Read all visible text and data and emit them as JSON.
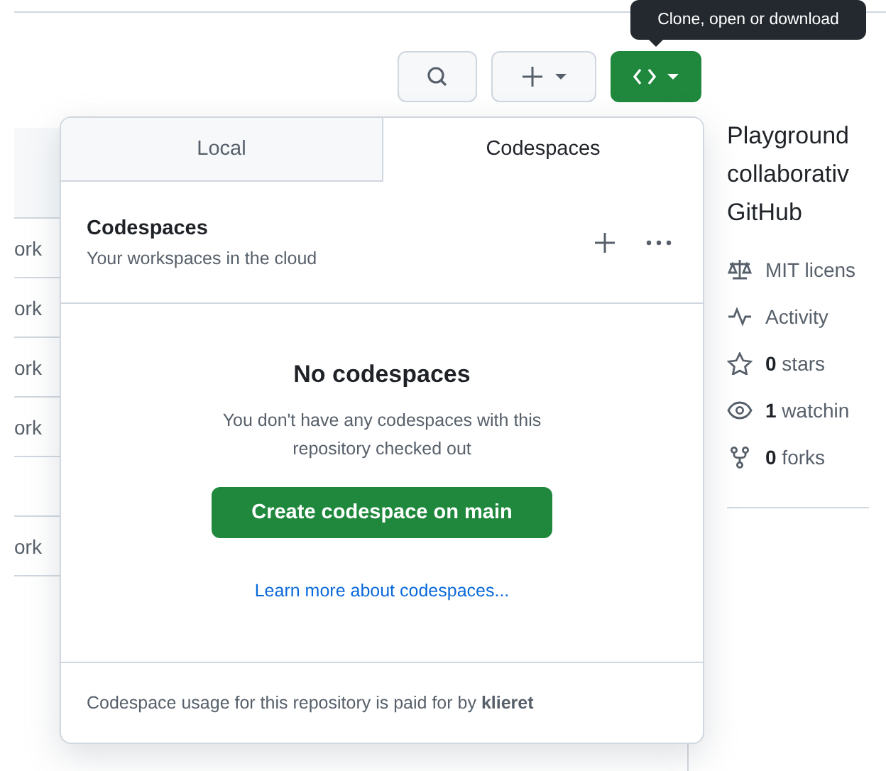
{
  "tooltip": {
    "text": "Clone, open or download"
  },
  "toolbar": {
    "buttons": [
      {
        "kind": "search"
      },
      {
        "kind": "add"
      },
      {
        "kind": "code"
      }
    ]
  },
  "file_rows": [
    {
      "kind": "file",
      "text": "ork"
    },
    {
      "kind": "file",
      "text": "ork"
    },
    {
      "kind": "file",
      "text": "ork"
    },
    {
      "kind": "file",
      "text": "ork"
    },
    {
      "kind": "blank"
    },
    {
      "kind": "file",
      "text": "ork"
    }
  ],
  "about": {
    "description_lines": [
      "Playground",
      "collaborativ",
      "GitHub"
    ],
    "stats": [
      {
        "kind": "license",
        "text": "MIT licens"
      },
      {
        "kind": "activity",
        "text": "Activity"
      },
      {
        "kind": "star",
        "text": "**0** stars"
      },
      {
        "kind": "eye",
        "text": "**1** watchin"
      },
      {
        "kind": "fork",
        "text": "**0** forks"
      }
    ]
  },
  "popover": {
    "tabs": [
      {
        "label": "Local",
        "selected": false
      },
      {
        "label": "Codespaces",
        "selected": true
      }
    ],
    "header": {
      "title": "Codespaces",
      "subtitle": "Your workspaces in the cloud"
    },
    "empty_state": {
      "title": "No codespaces",
      "description": "You don't have any codespaces with this repository checked out",
      "button": "Create codespace on main",
      "link": "Learn more about codespaces..."
    },
    "footer": "Codespace usage for this repository is paid for by **klieret**"
  }
}
